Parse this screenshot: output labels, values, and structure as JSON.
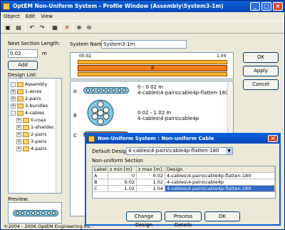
{
  "window": {
    "title": "OptEM Non-Uniform System - Profile Window  (Assembly\\System3-1m)",
    "controls": [
      "_",
      "□",
      "×"
    ]
  },
  "menu": [
    "Object",
    "Edit",
    "View"
  ],
  "left": {
    "next_section_label": "Next Section Length:",
    "next_section_value": "0.02",
    "next_section_unit": "m",
    "add_label": "Add",
    "design_list_label": "Design List:",
    "tree": [
      {
        "label": "Assembly",
        "level": 0,
        "exp": "-"
      },
      {
        "label": "1-wires",
        "level": 0,
        "exp": "+"
      },
      {
        "label": "2-pairs",
        "level": 0,
        "exp": "+"
      },
      {
        "label": "3-bundles",
        "level": 0,
        "exp": "+"
      },
      {
        "label": "4-cables",
        "level": 0,
        "exp": "-"
      },
      {
        "label": "0-coax",
        "level": 1,
        "exp": "+"
      },
      {
        "label": "1-shieldec",
        "level": 1,
        "exp": "+"
      },
      {
        "label": "2-pairs",
        "level": 1,
        "exp": "+"
      },
      {
        "label": "3-pairs",
        "level": 1,
        "exp": "+"
      },
      {
        "label": "4-pairs",
        "level": 1,
        "exp": "+"
      }
    ],
    "preview_label": "Preview:",
    "copyright": "©2004 - 2006 OptEM Engineering Inc."
  },
  "system": {
    "name_label": "System Name:",
    "name_value": "System3-1m",
    "ruler_start": "00.02",
    "ruler_end": "1.04",
    "ruler_mid": "B"
  },
  "sections": [
    {
      "label": "A",
      "range": "0 - 0.02 m",
      "design": "4-cables\\4-pairs\\cable4p-flatten-180"
    },
    {
      "label": "B",
      "range": "0.02 - 1.02 m",
      "design": "4-cables\\4-pairs\\cable4p"
    },
    {
      "label": "C",
      "range": "",
      "design": ""
    }
  ],
  "right_buttons": {
    "ok": "OK",
    "apply": "Apply",
    "cancel": "Cancel"
  },
  "dialog": {
    "title": "Non-Uniform System : Non-uniform Cable",
    "default_design_label": "Default Design:",
    "default_design_value": "4-cables\\4-pairs\\cable4p-flatten-180",
    "section_label": "Non-uniform Section",
    "columns": [
      "Label",
      "z min [m]",
      "z max [m]",
      "Design"
    ],
    "rows": [
      {
        "label": "A",
        "zmin": "0",
        "zmax": "0.02",
        "design": "4-cables\\4-pairs\\cable4p-flatten-180"
      },
      {
        "label": "B",
        "zmin": "0.02",
        "zmax": "1.02",
        "design": "4-cables\\4-pairs\\cable4p"
      },
      {
        "label": "C",
        "zmin": "1.02",
        "zmax": "1.04",
        "design": "4-cables\\4-pairs\\cable4p-flatten-180"
      }
    ],
    "buttons": {
      "change": "Change Design",
      "process": "Process Details",
      "ok": "OK"
    }
  }
}
